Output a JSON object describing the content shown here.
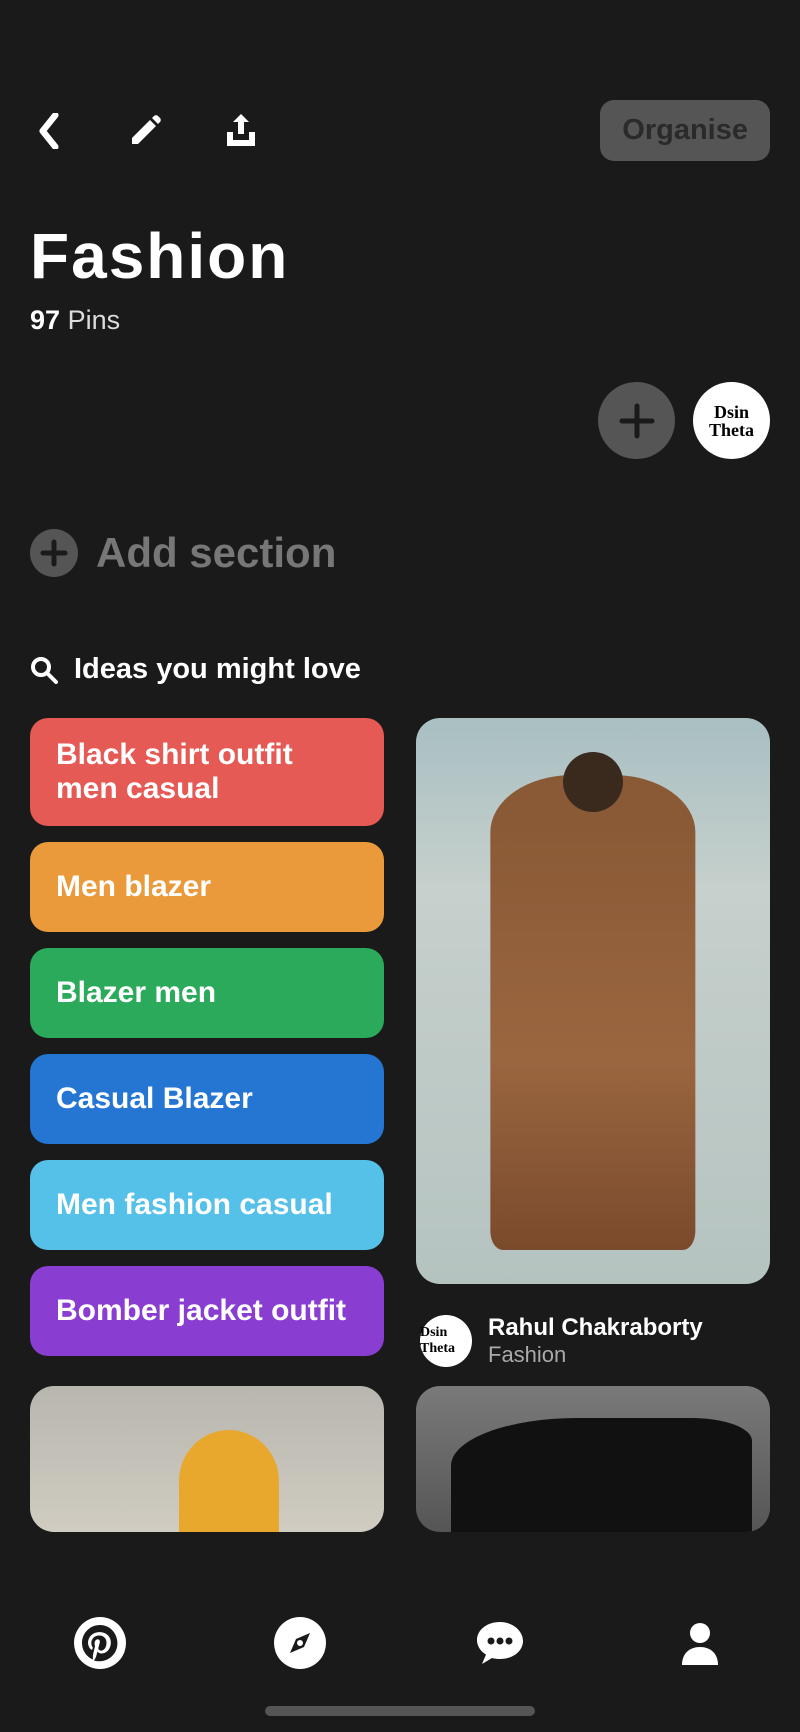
{
  "toolbar": {
    "organise_label": "Organise"
  },
  "board": {
    "title": "Fashion",
    "pin_count": "97",
    "pin_label": "Pins",
    "avatar_text": "Dsin Theta"
  },
  "add_section": {
    "label": "Add section"
  },
  "ideas": {
    "header": "Ideas you might love",
    "chips": [
      {
        "label": "Black shirt outfit men casual",
        "color": "c-red"
      },
      {
        "label": "Men blazer",
        "color": "c-orange"
      },
      {
        "label": "Blazer men",
        "color": "c-green"
      },
      {
        "label": "Casual Blazer",
        "color": "c-blue"
      },
      {
        "label": "Men fashion casual",
        "color": "c-cyan"
      },
      {
        "label": "Bomber jacket outfit",
        "color": "c-purple"
      }
    ]
  },
  "pins": {
    "first": {
      "author": "Rahul Chakraborty",
      "board": "Fashion",
      "avatar_text": "Dsin Theta"
    }
  }
}
